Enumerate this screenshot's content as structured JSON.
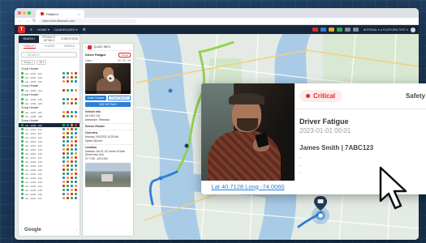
{
  "browser": {
    "tab_title": "Platform",
    "url": "https://web.fleetcam.com",
    "tab_close": "×"
  },
  "app_header": {
    "logo_text": "T",
    "menu_items": [
      "HOME ▾",
      "DASHBOARD ▾"
    ],
    "user_label": "INTERNAL ▾  ● PLATFORM TEST ▾"
  },
  "sidebar": {
    "tabs": [
      "SEARCH",
      "PRODUCT DETAILS",
      "CONDITIONS"
    ],
    "subtabs": [
      "FORKLIFT",
      "PLATES",
      "VEHICLE"
    ],
    "search_placeholder": "SEARCH",
    "filters": [
      "Group ▾",
      "All ▾"
    ],
    "groups": [
      {
        "label": "Group Header",
        "rows": [
          "AA - 1001 - 101",
          "AA - 1002 - 102",
          "AA - 1003 - 103"
        ]
      },
      {
        "label": "Group Header",
        "rows": [
          "AA - 1004 - 104"
        ]
      },
      {
        "label": "Group Header",
        "rows": [
          "AA - 1005 - 105",
          "AA - 1006 - 106"
        ]
      },
      {
        "label": "Group Header",
        "rows": [
          "AA - 1007 - 107",
          "AA - 1008 - 108"
        ]
      },
      {
        "label": "Group Header",
        "rows": [
          "AA - 1009 - 109",
          "AA - 1010 - 110",
          "AA - 1011 - 111",
          "AA - 1012 - 112",
          "AA - 1013 - 113",
          "AA - 1014 - 114",
          "AA - 1015 - 115",
          "AA - 1016 - 116",
          "AA - 1017 - 117",
          "AA - 1018 - 118",
          "AA - 1019 - 119",
          "AA - 1020 - 120",
          "AA - 1021 - 121",
          "AA - 1022 - 122",
          "AA - 1023 - 123",
          "AA - 1024 - 124",
          "AA - 1025 - 125",
          "AA - 1026 - 126",
          "AA - 1027 - 127"
        ]
      }
    ],
    "pager_left": "‹",
    "pager_right": "›"
  },
  "event_panel": {
    "header": "QUICK INFO",
    "title": "Driver Fatigue",
    "badge": "Critical",
    "video_label": "Video",
    "video_time": "00 : 00 : 00",
    "play": "▶",
    "cam_buttons": [
      "Cabin Camera",
      "Front Camera"
    ],
    "see_details": "SEE DETAILS",
    "sections": [
      {
        "title": "Vehicle info",
        "lines": [
          "AA 1001-101",
          "Alexandra  ·  Rebecka"
        ]
      },
      {
        "title": "Sensor Reader",
        "lines": []
      },
      {
        "title": "Overview",
        "lines": [
          "Monday 1/01/2023 10:23 AM",
          "Speed  48 km/h"
        ]
      },
      {
        "title": "Location",
        "lines": [
          "Address: 3rd St, 43 Centre of Main Street New York",
          "37.7749, -122.4194"
        ]
      }
    ],
    "chevron": "⌄"
  },
  "event_card": {
    "severity": "Critical",
    "category": "Safety Event",
    "event_name": "Driver Fatigue",
    "date": "2023-01-01 00:01",
    "driver": "James Smith | 7ABC123",
    "more_lines": [
      "–",
      "–",
      "–"
    ],
    "lat_long": "Lat 40.7128 Long -74.0060"
  },
  "map": {
    "attribution": "Google"
  },
  "colors": {
    "brand_red": "#d92d2d",
    "header_navy": "#17263a",
    "route_green": "#8fd14f",
    "route_blue": "#2d7fd4",
    "marker_blue": "#1f6fc9"
  }
}
